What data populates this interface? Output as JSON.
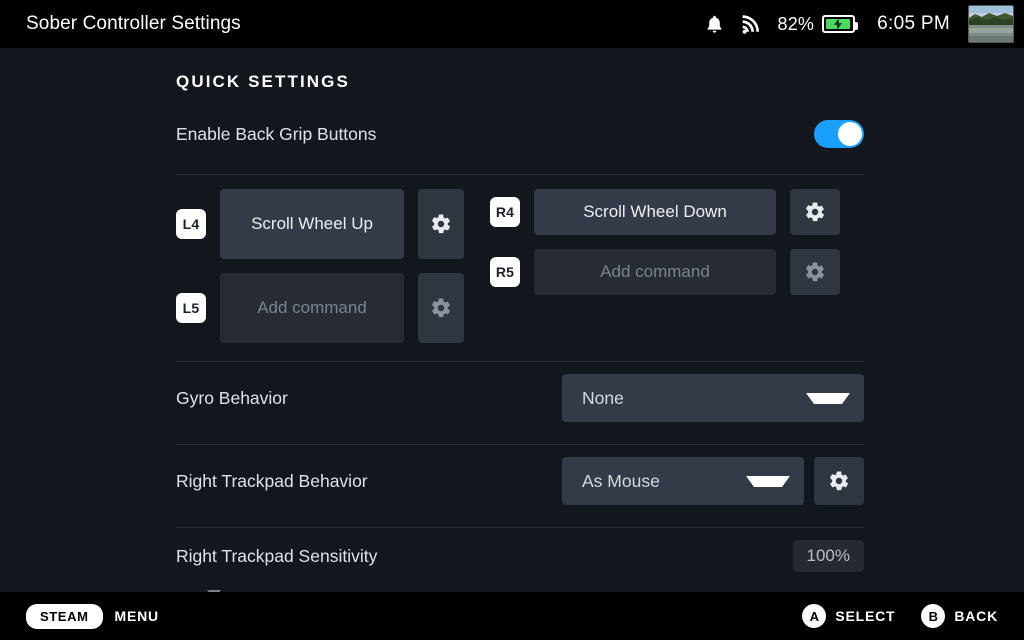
{
  "topbar": {
    "title": "Sober Controller Settings",
    "notification_icon": "bell-icon",
    "network_icon": "wifi-signal-icon",
    "battery_percent": "82%",
    "battery_charging": true,
    "battery_color": "#4cd964",
    "clock": "6:05 PM",
    "avatar_alt": "user-avatar"
  },
  "main": {
    "section_title": "QUICK SETTINGS",
    "enable_back_grip": {
      "label": "Enable Back Grip Buttons",
      "state": "on",
      "accent": "#1a9fff"
    },
    "back_grip_bindings": [
      {
        "key": "L4",
        "command": "Scroll Wheel Up",
        "assigned": true
      },
      {
        "key": "L5",
        "command": "Add command",
        "assigned": false
      },
      {
        "key": "R4",
        "command": "Scroll Wheel Down",
        "assigned": true
      },
      {
        "key": "R5",
        "command": "Add command",
        "assigned": false
      }
    ],
    "gyro_behavior": {
      "label": "Gyro Behavior",
      "value": "None"
    },
    "right_trackpad_behavior": {
      "label": "Right Trackpad Behavior",
      "value": "As Mouse"
    },
    "right_trackpad_sensitivity": {
      "label": "Right Trackpad Sensitivity",
      "value": "100%"
    }
  },
  "footer": {
    "steam_label": "STEAM",
    "menu_label": "MENU",
    "select_button": "A",
    "select_label": "SELECT",
    "back_button": "B",
    "back_label": "BACK"
  }
}
